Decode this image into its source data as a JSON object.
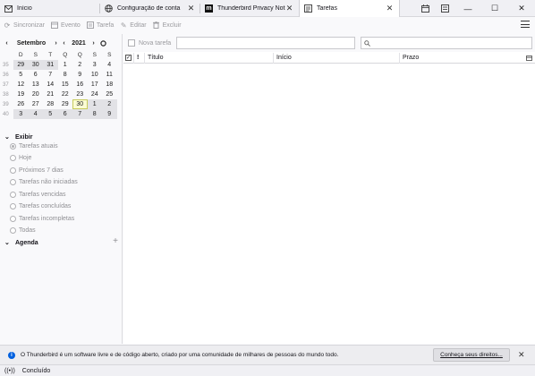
{
  "tabs": [
    {
      "label": "Início",
      "icon": "mail-icon",
      "closable": false,
      "active": false
    },
    {
      "label": "Configuração de conta",
      "icon": "globe-icon",
      "closable": true,
      "active": false
    },
    {
      "label": "Thunderbird Privacy Notice",
      "icon": "mozilla-icon",
      "closable": true,
      "active": false
    },
    {
      "label": "Tarefas",
      "icon": "tasks-icon",
      "closable": true,
      "active": true
    }
  ],
  "toolbar": {
    "sync_label": "Sincronizar",
    "event_label": "Evento",
    "task_label": "Tarefa",
    "edit_label": "Editar",
    "delete_label": "Excluir"
  },
  "minimonth": {
    "month": "Setembro",
    "year": "2021",
    "weekday_headers": [
      "D",
      "S",
      "T",
      "Q",
      "Q",
      "S",
      "S"
    ],
    "weeks": [
      {
        "week": "35",
        "days": [
          {
            "d": "29",
            "other": true
          },
          {
            "d": "30",
            "other": true
          },
          {
            "d": "31",
            "other": true
          },
          {
            "d": "1"
          },
          {
            "d": "2"
          },
          {
            "d": "3"
          },
          {
            "d": "4"
          }
        ]
      },
      {
        "week": "36",
        "days": [
          {
            "d": "5"
          },
          {
            "d": "6"
          },
          {
            "d": "7"
          },
          {
            "d": "8"
          },
          {
            "d": "9"
          },
          {
            "d": "10"
          },
          {
            "d": "11"
          }
        ]
      },
      {
        "week": "37",
        "days": [
          {
            "d": "12"
          },
          {
            "d": "13"
          },
          {
            "d": "14"
          },
          {
            "d": "15"
          },
          {
            "d": "16"
          },
          {
            "d": "17"
          },
          {
            "d": "18"
          }
        ]
      },
      {
        "week": "38",
        "days": [
          {
            "d": "19"
          },
          {
            "d": "20"
          },
          {
            "d": "21"
          },
          {
            "d": "22"
          },
          {
            "d": "23"
          },
          {
            "d": "24"
          },
          {
            "d": "25"
          }
        ]
      },
      {
        "week": "39",
        "days": [
          {
            "d": "26"
          },
          {
            "d": "27"
          },
          {
            "d": "28"
          },
          {
            "d": "29"
          },
          {
            "d": "30",
            "today": true
          },
          {
            "d": "1",
            "other": true
          },
          {
            "d": "2",
            "other": true
          }
        ]
      },
      {
        "week": "40",
        "days": [
          {
            "d": "3",
            "other": true
          },
          {
            "d": "4",
            "other": true
          },
          {
            "d": "5",
            "other": true
          },
          {
            "d": "6",
            "other": true
          },
          {
            "d": "7",
            "other": true
          },
          {
            "d": "8",
            "other": true
          },
          {
            "d": "9",
            "other": true
          }
        ]
      }
    ]
  },
  "filter": {
    "header": "Exibir",
    "options": [
      {
        "label": "Tarefas atuais",
        "checked": true
      },
      {
        "label": "Hoje",
        "checked": false
      },
      {
        "label": "Próximos 7 dias",
        "checked": false
      },
      {
        "label": "Tarefas não iniciadas",
        "checked": false
      },
      {
        "label": "Tarefas vencidas",
        "checked": false
      },
      {
        "label": "Tarefas concluídas",
        "checked": false
      },
      {
        "label": "Tarefas incompletas",
        "checked": false
      },
      {
        "label": "Todas",
        "checked": false
      }
    ]
  },
  "agenda": {
    "header": "Agenda"
  },
  "tasks": {
    "new_task_label": "Nova tarefa",
    "new_task_value": "",
    "search_placeholder": "",
    "columns": {
      "priority": "!",
      "title": "Título",
      "start": "Início",
      "due": "Prazo"
    }
  },
  "notification": {
    "text": "O Thunderbird é um software livre e de código aberto, criado por uma comunidade de milhares de pessoas do mundo todo.",
    "button": "Conheça seus direitos..."
  },
  "status": {
    "text": "Concluído"
  }
}
